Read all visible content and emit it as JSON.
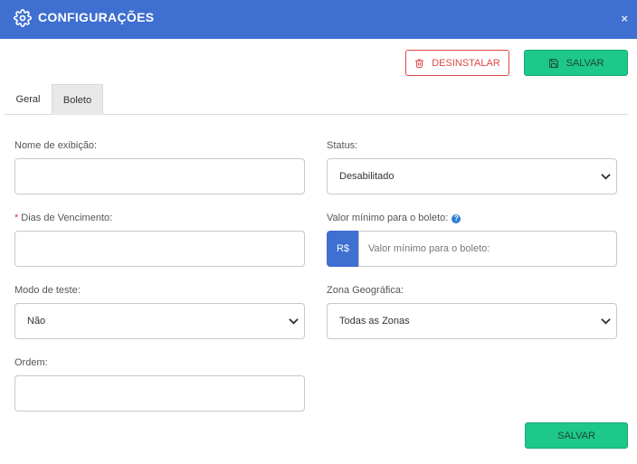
{
  "header": {
    "title": "CONFIGURAÇÕES",
    "close": "×",
    "icon": "gear-icon"
  },
  "toolbar": {
    "uninstall_label": "DESINSTALAR",
    "save_label": "SALVAR"
  },
  "tabs": [
    {
      "label": "Geral",
      "active": false
    },
    {
      "label": "Boleto",
      "active": true
    }
  ],
  "form": {
    "display_name": {
      "label": "Nome de exibição:",
      "value": ""
    },
    "status": {
      "label": "Status:",
      "value": "Desabilitado"
    },
    "due_days": {
      "label": "Dias de Vencimento:",
      "required_mark": "*",
      "value": ""
    },
    "min_value": {
      "label": "Valor mínimo para o boleto:",
      "help": "?",
      "prefix": "R$",
      "placeholder": "Valor mínimo para o boleto:"
    },
    "test_mode": {
      "label": "Modo de teste:",
      "value": "Não"
    },
    "geo_zone": {
      "label": "Zona Geográfica:",
      "value": "Todas as Zonas"
    },
    "order": {
      "label": "Ordem:",
      "value": ""
    }
  },
  "footer": {
    "save_label": "SALVAR"
  },
  "colors": {
    "header": "#3f6fd0",
    "save": "#1ec78a",
    "danger": "#e04848",
    "addon": "#3f6fd0"
  }
}
